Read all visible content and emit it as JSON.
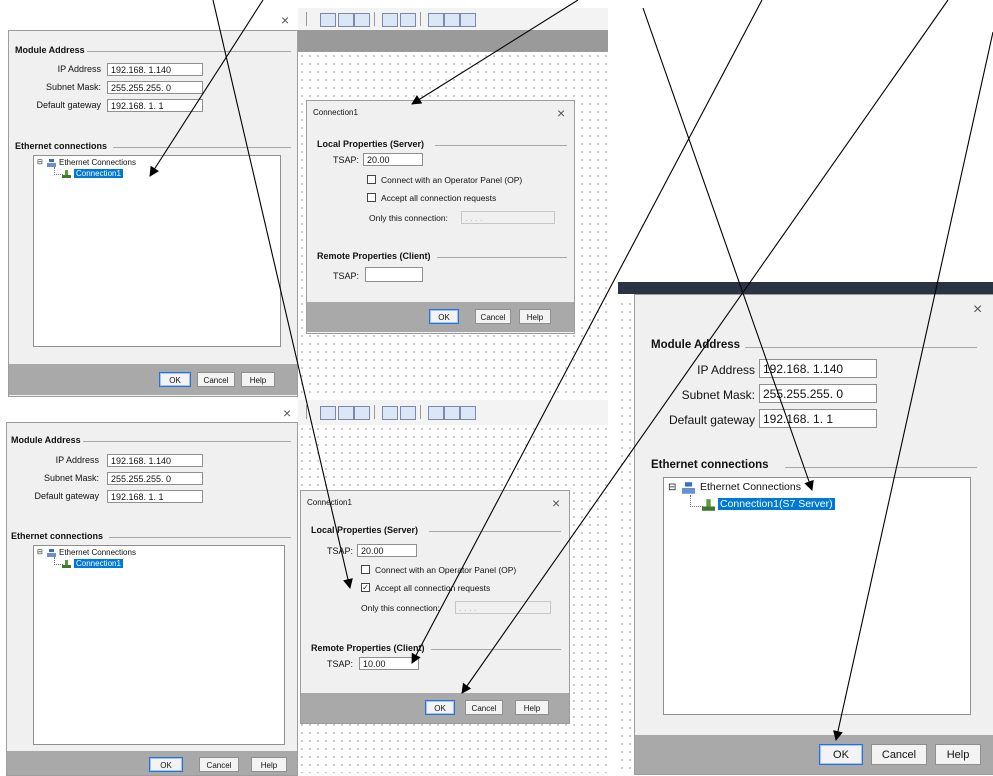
{
  "colors": {
    "selection": "#0078d7",
    "footer": "#a9a9a9",
    "dialog_bg": "#f0f0f0",
    "arrow": "#000000"
  },
  "panel_tl": {
    "close": "×",
    "module_address_title": "Module Address",
    "ip_label": "IP Address",
    "ip_value": "192.168. 1.140",
    "mask_label": "Subnet Mask:",
    "mask_value": "255.255.255. 0",
    "gw_label": "Default gateway",
    "gw_value": "192.168. 1. 1",
    "eth_title": "Ethernet connections",
    "tree_root": "Ethernet Connections",
    "tree_child": "Connection1",
    "ok": "OK",
    "cancel": "Cancel",
    "help": "Help"
  },
  "conn_top": {
    "title": "Connection1",
    "close": "×",
    "local_title": "Local Properties (Server)",
    "tsap_label": "TSAP:",
    "tsap_value": "20.00",
    "cb_op_label": "Connect with an Operator Panel (OP)",
    "cb_accept_label": "Accept all connection requests",
    "only_label": "Only this connection:",
    "only_value": ". . . .",
    "remote_title": "Remote Properties (Client)",
    "remote_tsap_label": "TSAP:",
    "remote_tsap_value": "",
    "ok": "OK",
    "cancel": "Cancel",
    "help": "Help"
  },
  "panel_bl": {
    "close": "×",
    "module_address_title": "Module Address",
    "ip_label": "IP Address",
    "ip_value": "192.168. 1.140",
    "mask_label": "Subnet Mask:",
    "mask_value": "255.255.255. 0",
    "gw_label": "Default gateway",
    "gw_value": "192.168. 1. 1",
    "eth_title": "Ethernet connections",
    "tree_root": "Ethernet Connections",
    "tree_child": "Connection1",
    "ok": "OK",
    "cancel": "Cancel",
    "help": "Help"
  },
  "conn_bottom": {
    "title": "Connection1",
    "close": "×",
    "local_title": "Local Properties (Server)",
    "tsap_label": "TSAP:",
    "tsap_value": "20.00",
    "cb_op_label": "Connect with an Operator Panel (OP)",
    "cb_accept_label": "Accept all connection requests",
    "cb_accept_checked": true,
    "only_label": "Only this connection:",
    "only_value": ". . . .",
    "remote_title": "Remote Properties (Client)",
    "remote_tsap_label": "TSAP:",
    "remote_tsap_value": "10.00",
    "ok": "OK",
    "cancel": "Cancel",
    "help": "Help"
  },
  "panel_big": {
    "close": "×",
    "module_address_title": "Module Address",
    "ip_label": "IP Address",
    "ip_value": "192.168. 1.140",
    "mask_label": "Subnet Mask:",
    "mask_value": "255.255.255. 0",
    "gw_label": "Default gateway",
    "gw_value": "192.168. 1. 1",
    "eth_title": "Ethernet connections",
    "tree_root": "Ethernet Connections",
    "tree_child": "Connection1(S7 Server)",
    "ok": "OK",
    "cancel": "Cancel",
    "help": "Help"
  }
}
